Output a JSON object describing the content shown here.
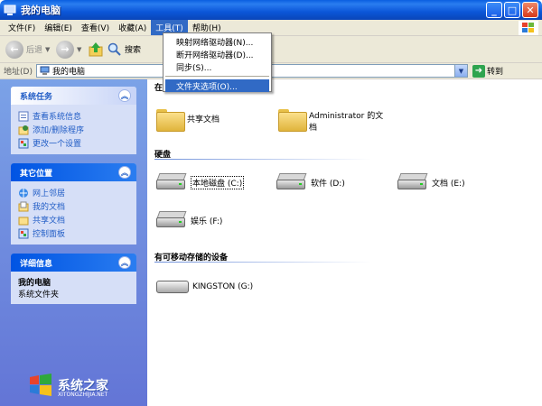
{
  "window": {
    "title": "我的电脑"
  },
  "menubar": [
    "文件(F)",
    "编辑(E)",
    "查看(V)",
    "收藏(A)",
    "工具(T)",
    "帮助(H)"
  ],
  "toolbar": {
    "back": "后退",
    "search": "搜索"
  },
  "address": {
    "label": "地址(D)",
    "value": "我的电脑",
    "go": "转到"
  },
  "dropdown": {
    "items": [
      "映射网络驱动器(N)...",
      "断开网络驱动器(D)...",
      "同步(S)...",
      "文件夹选项(O)..."
    ],
    "highlighted_index": 3
  },
  "sidebar": {
    "system_tasks": {
      "title": "系统任务",
      "links": [
        "查看系统信息",
        "添加/删除程序",
        "更改一个设置"
      ]
    },
    "other_places": {
      "title": "其它位置",
      "links": [
        "网上邻居",
        "我的文档",
        "共享文档",
        "控制面板"
      ]
    },
    "details": {
      "title": "详细信息",
      "name": "我的电脑",
      "type": "系统文件夹"
    }
  },
  "main": {
    "section_partial": "在",
    "files": [
      "共享文档",
      "Administrator 的文档"
    ],
    "hard_disks_title": "硬盘",
    "hard_disks": [
      "本地磁盘 (C:)",
      "软件 (D:)",
      "文档 (E:)",
      "娱乐 (F:)"
    ],
    "removable_title": "有可移动存储的设备",
    "removable": [
      "KINGSTON (G:)"
    ]
  },
  "watermark": {
    "text": "系统之家",
    "sub": "XITONGZHIJIA.NET"
  },
  "colors": {
    "title_blue": "#0a5fe0",
    "menu_highlight": "#316ac5",
    "sidebar_blue": "#7ba2e7"
  }
}
